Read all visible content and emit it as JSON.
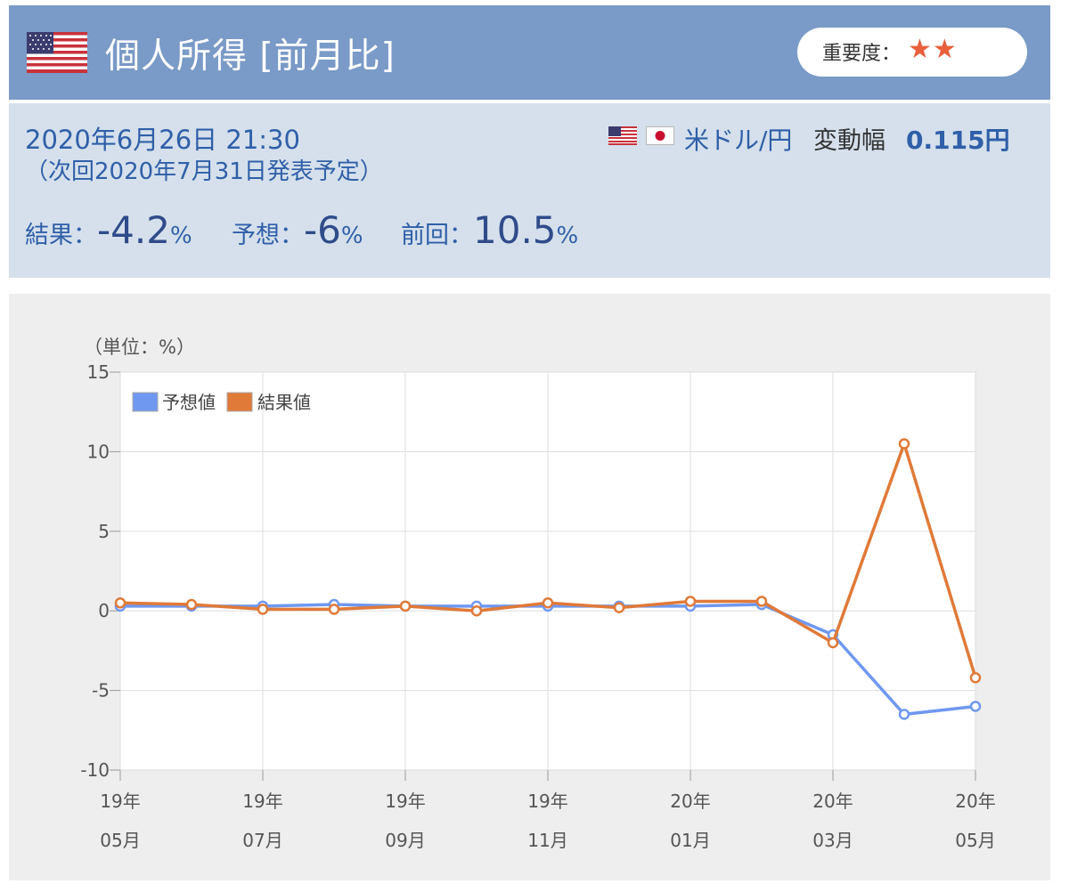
{
  "header": {
    "title": "個人所得 [前月比]",
    "importance_label": "重要度：",
    "importance_stars": "★★",
    "flag_icon": "us-flag-icon"
  },
  "release": {
    "datetime": "2020年6月26日 21:30",
    "next_release": "（次回2020年7月31日発表予定）",
    "pair": "米ドル/円",
    "range_label": "変動幅",
    "range_value": "0.115円",
    "result_label": "結果：",
    "result_value": "-4.2",
    "forecast_label": "予想：",
    "forecast_value": "-6",
    "previous_label": "前回：",
    "previous_value": "10.5",
    "percent": "%"
  },
  "colors": {
    "header_bg": "#7a9ac7",
    "info_bg": "#d5e0ec",
    "forecast_series": "#6f98f0",
    "result_series": "#e07a38",
    "star": "#e8603c"
  },
  "chart_data": {
    "type": "line",
    "unit_label": "（単位：%）",
    "x": [
      "19年05月",
      "19年06月",
      "19年07月",
      "19年08月",
      "19年09月",
      "19年10月",
      "19年11月",
      "19年12月",
      "20年01月",
      "20年02月",
      "20年03月",
      "20年04月",
      "20年05月"
    ],
    "tick_labels": [
      {
        "year": "19年",
        "month": "05月",
        "index": 0
      },
      {
        "year": "19年",
        "month": "07月",
        "index": 2
      },
      {
        "year": "19年",
        "month": "09月",
        "index": 4
      },
      {
        "year": "19年",
        "month": "11月",
        "index": 6
      },
      {
        "year": "20年",
        "month": "01月",
        "index": 8
      },
      {
        "year": "20年",
        "month": "03月",
        "index": 10
      },
      {
        "year": "20年",
        "month": "05月",
        "index": 12
      }
    ],
    "series": [
      {
        "name": "予想値",
        "values": [
          0.3,
          0.3,
          0.3,
          0.4,
          0.3,
          0.3,
          0.3,
          0.3,
          0.3,
          0.4,
          -1.5,
          -6.5,
          -6.0
        ]
      },
      {
        "name": "結果値",
        "values": [
          0.5,
          0.4,
          0.1,
          0.1,
          0.3,
          0.0,
          0.5,
          0.2,
          0.6,
          0.6,
          -2.0,
          10.5,
          -4.2
        ]
      }
    ],
    "ylim": [
      -10,
      15
    ],
    "yticks": [
      15,
      10,
      5,
      0,
      -5,
      -10
    ],
    "grid": true,
    "legend": "top-left"
  }
}
